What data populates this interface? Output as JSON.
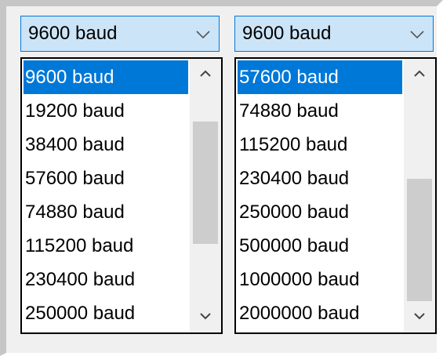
{
  "combos": [
    {
      "value": "9600 baud",
      "arrow_icon": "chevron-down-icon",
      "options": [
        "9600 baud",
        "19200 baud",
        "38400 baud",
        "57600 baud",
        "74880 baud",
        "115200 baud",
        "230400 baud",
        "250000 baud"
      ],
      "selected_index": 0,
      "scroll_position": 0.35
    },
    {
      "value": "9600 baud",
      "arrow_icon": "chevron-down-icon",
      "options": [
        "57600 baud",
        "74880 baud",
        "115200 baud",
        "230400 baud",
        "250000 baud",
        "500000 baud",
        "1000000 baud",
        "2000000 baud"
      ],
      "selected_index": 0,
      "scroll_position": 1.0
    }
  ],
  "scroll_up_icon": "chevron-up-icon",
  "scroll_down_icon": "chevron-down-icon",
  "colors": {
    "selection": "#0078d7",
    "combo_background": "#cce4f7",
    "panel_background": "#f0f0f0"
  }
}
